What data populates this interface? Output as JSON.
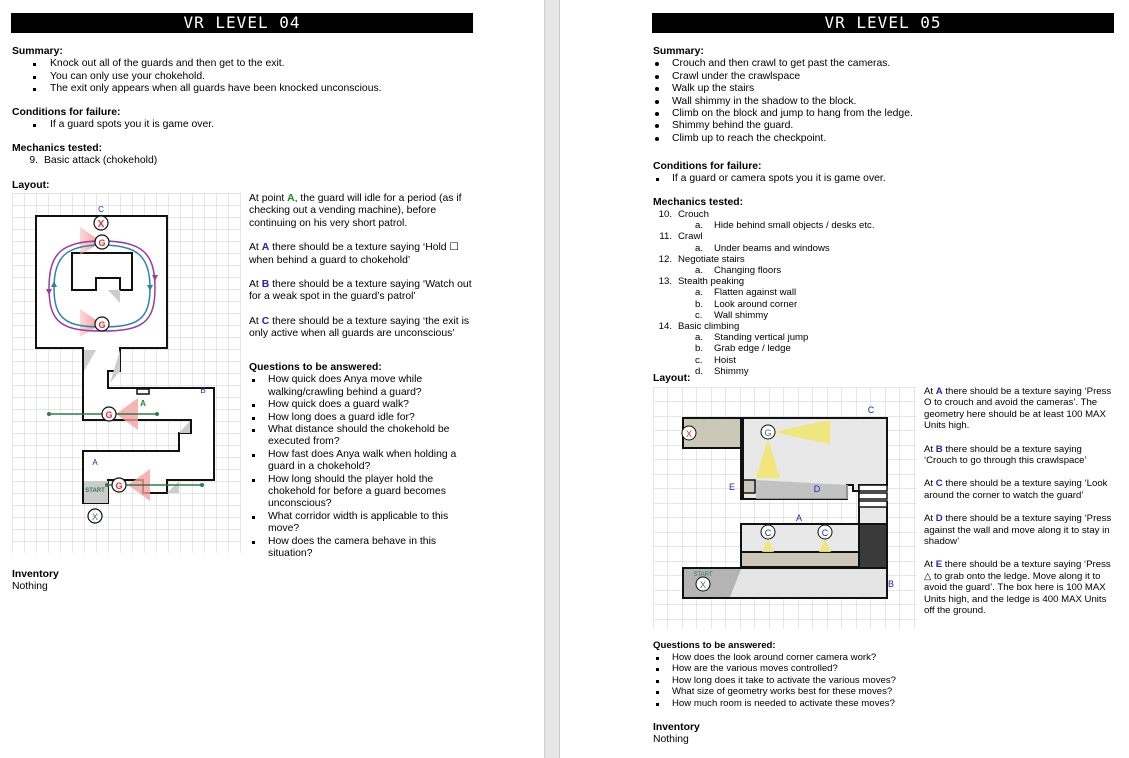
{
  "left": {
    "title": "VR LEVEL 04",
    "summary_heading": "Summary:",
    "summary": [
      "Knock out all of the guards and then get to the exit.",
      "You can only use your chokehold.",
      "The exit only appears when all guards have been knocked unconscious."
    ],
    "failure_heading": "Conditions for failure:",
    "failure": [
      "If a guard spots you it is game over."
    ],
    "mechanics_heading": "Mechanics tested:",
    "mechanics": [
      {
        "num": "9.",
        "label": "Basic attack (chokehold)",
        "subs": []
      }
    ],
    "layout_heading": "Layout:",
    "notes": [
      {
        "pre": "At point ",
        "mark": "A",
        "mark_color": "green",
        "post": ", the guard will idle for a period (as if checking out a vending machine), before continuing on his very short patrol."
      },
      {
        "pre": "At ",
        "mark": "A",
        "mark_color": "blue",
        "post": " there should be a texture saying ‘Hold ☐ when behind a guard to chokehold’"
      },
      {
        "pre": "At ",
        "mark": "B",
        "mark_color": "blue",
        "post": " there should be a texture saying ‘Watch out for a weak spot in the guard’s patrol’"
      },
      {
        "pre": "At ",
        "mark": "C",
        "mark_color": "blue",
        "post": " there should be a texture saying ‘the exit is only active when all guards are unconscious’"
      }
    ],
    "questions_heading": "Questions to be answered:",
    "questions": [
      "How quick does Anya move while walking/crawling behind a guard?",
      "How quick does a guard walk?",
      "How long does a guard idle for?",
      "What distance should the chokehold be executed from?",
      "How fast does Anya walk when holding a guard in a chokehold?",
      "How long should the player hold the chokehold for before a guard becomes unconscious?",
      "What corridor width is applicable to this move?",
      "How does the camera behave in this situation?"
    ],
    "inventory_heading": "Inventory",
    "inventory": "Nothing",
    "map": {
      "label_c": "C",
      "label_b": "B",
      "label_a_blue": "A",
      "label_a_green": "A",
      "exit_glyph": "X",
      "guard_glyph": "G",
      "start_label": "START",
      "start_glyph": "X"
    }
  },
  "right": {
    "title": "VR LEVEL 05",
    "summary_heading": "Summary:",
    "summary": [
      "Crouch and then crawl to get past the cameras.",
      "Crawl under the crawlspace",
      "Walk up the stairs",
      "Wall shimmy in the shadow to the block.",
      "Climb on the block and jump to hang from the ledge.",
      "Shimmy behind the guard.",
      "Climb up to reach the checkpoint."
    ],
    "failure_heading": "Conditions for failure:",
    "failure": [
      "If a guard or camera spots you it is game over."
    ],
    "mechanics_heading": "Mechanics tested:",
    "mechanics": [
      {
        "num": "10.",
        "label": "Crouch",
        "subs": [
          {
            "l": "a.",
            "t": "Hide behind small objects / desks etc."
          }
        ]
      },
      {
        "num": "11.",
        "label": "Crawl",
        "subs": [
          {
            "l": "a.",
            "t": "Under beams and windows"
          }
        ]
      },
      {
        "num": "12.",
        "label": "Negotiate stairs",
        "subs": [
          {
            "l": "a.",
            "t": "Changing floors"
          }
        ]
      },
      {
        "num": "13.",
        "label": "Stealth peaking",
        "subs": [
          {
            "l": "a.",
            "t": "Flatten against wall"
          },
          {
            "l": "b.",
            "t": "Look around corner"
          },
          {
            "l": "c.",
            "t": "Wall shimmy"
          }
        ]
      },
      {
        "num": "14.",
        "label": "Basic climbing",
        "subs": [
          {
            "l": "a.",
            "t": "Standing vertical jump"
          },
          {
            "l": "b.",
            "t": "Grab edge / ledge"
          },
          {
            "l": "c.",
            "t": "Hoist"
          },
          {
            "l": "d.",
            "t": "Shimmy"
          }
        ]
      }
    ],
    "layout_heading": "Layout:",
    "notes": [
      {
        "pre": "At ",
        "mark": "A",
        "mark_color": "blue",
        "post": " there should be a texture saying ‘Press O to crouch and avoid the cameras’. The geometry here should be at least 100 MAX Units high."
      },
      {
        "pre": "At ",
        "mark": "B",
        "mark_color": "blue",
        "post": " there should be a texture saying ‘Crouch to go through this crawlspace’"
      },
      {
        "pre": "At ",
        "mark": "C",
        "mark_color": "blue",
        "post": " there should be a texture saying ‘Look around the corner to watch the guard’"
      },
      {
        "pre": "At ",
        "mark": "D",
        "mark_color": "blue",
        "post": " there should be a texture saying ‘Press against the wall and move along it to stay in shadow’"
      },
      {
        "pre": "At ",
        "mark": "E",
        "mark_color": "blue",
        "post": " there should be a texture saying ‘Press △ to grab onto the ledge. Move along it to avoid the guard’. The box here is 100 MAX Units high, and the ledge is 400 MAX Units off the ground."
      }
    ],
    "questions_heading": "Questions to be answered:",
    "questions": [
      "How does the look around corner camera work?",
      "How are the various moves controlled?",
      "How long does it take to activate the various moves?",
      "What size of geometry works best for these moves?",
      "How much room is needed to activate these moves?"
    ],
    "inventory_heading": "Inventory",
    "inventory": "Nothing",
    "map": {
      "label_a": "A",
      "label_b": "B",
      "label_c": "C",
      "label_d": "D",
      "label_e": "E",
      "exit_glyph": "X",
      "guard_glyph": "G",
      "camera_glyph": "C",
      "start_label": "START",
      "start_glyph": "X"
    }
  },
  "colors": {
    "title_bg": "#000000",
    "mark_green": "#1e8a1e",
    "mark_blue": "#2323b4",
    "guard_red": "#e03030",
    "patrol_purple": "#9a3ca0",
    "patrol_teal": "#2a86a8",
    "patrol_green": "#2e7d4a",
    "camera_yellow": "#f2e670"
  }
}
